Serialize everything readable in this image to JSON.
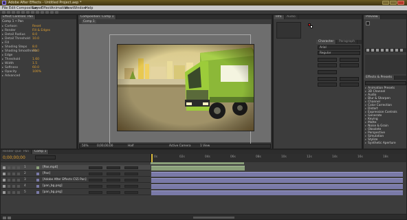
{
  "window": {
    "title": "Adobe After Effects - Untitled Project.aep *"
  },
  "menu": [
    "File",
    "Edit",
    "Composition",
    "Layer",
    "Effect",
    "Animation",
    "View",
    "Window",
    "Help"
  ],
  "effect_controls": {
    "tab": "Effect Controls: Pan",
    "subtitle": "Comp 1 • Pan",
    "properties": [
      {
        "label": "Cartoon",
        "value": "Reset"
      },
      {
        "label": "Render",
        "value": "Fill & Edges"
      },
      {
        "label": "Detail Radius",
        "value": "8.0"
      },
      {
        "label": "Detail Threshold",
        "value": "10.0"
      },
      {
        "label": "Fill",
        "value": ""
      },
      {
        "label": "Shading Steps",
        "value": "8.0"
      },
      {
        "label": "Shading Smoothness",
        "value": "70.0"
      },
      {
        "label": "Edge",
        "value": ""
      },
      {
        "label": "Threshold",
        "value": "1.60"
      },
      {
        "label": "Width",
        "value": "1.5"
      },
      {
        "label": "Softness",
        "value": "60.0"
      },
      {
        "label": "Opacity",
        "value": "100%"
      },
      {
        "label": "Advanced",
        "value": ""
      }
    ]
  },
  "composition": {
    "tab": "Composition: Comp 1",
    "subtab": "Comp 1",
    "footer": {
      "zoom": "50%",
      "time": "0;00;00;00",
      "resolution": "Half",
      "camera": "Active Camera",
      "views": "1 View"
    }
  },
  "info_panel": {
    "tabs": [
      "Info",
      "Audio"
    ],
    "paragraph_tabs": [
      "Character",
      "Paragraph"
    ],
    "font": "Arial",
    "style": "Regular"
  },
  "right_panel": {
    "tabs": [
      "Preview"
    ],
    "effects_tab": "Effects & Presets",
    "search_placeholder": "",
    "categories": [
      "Animation Presets",
      "3D Channel",
      "Audio",
      "Blur & Sharpen",
      "Channel",
      "Color Correction",
      "Distort",
      "Expression Controls",
      "Generate",
      "Keying",
      "Matte",
      "Noise & Grain",
      "Obsolete",
      "Perspective",
      "Simulation",
      "Stylize",
      "Synthetic Aperture"
    ]
  },
  "timeline": {
    "tabs": [
      "Render Queue",
      "Pan",
      "Comp 1"
    ],
    "timecode": "0;00;00;00",
    "layers": [
      {
        "num": "1",
        "name": "[Pan.mp4]"
      },
      {
        "num": "2",
        "name": "[Pan]"
      },
      {
        "num": "3",
        "name": "[Adobe After Effects CS5 Pan]"
      },
      {
        "num": "4",
        "name": "[pan_bg.png]"
      },
      {
        "num": "5",
        "name": "[pan_bg.png]"
      }
    ],
    "ruler": [
      "0s",
      "02s",
      "04s",
      "06s",
      "08s",
      "10s",
      "12s",
      "14s",
      "16s",
      "18s"
    ]
  },
  "colors": {
    "title_bar": "#5a4a1a",
    "panel_bg": "#3c3c3c",
    "comp_bg": "#6e6e6e",
    "accent_value": "#e0a030",
    "layer_bar": "#7a7aa8"
  }
}
